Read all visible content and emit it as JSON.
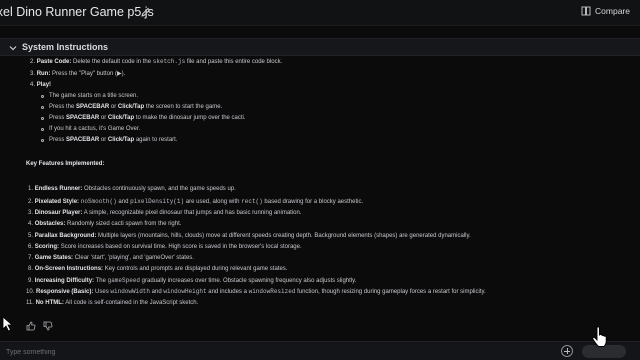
{
  "header": {
    "title": "ixel Dino Runner Game p5.js",
    "compare_label": "Compare"
  },
  "system_instructions": {
    "label": "System Instructions"
  },
  "steps": [
    {
      "num": "2.",
      "label": "Paste Code:",
      "text_a": " Delete the default code in the ",
      "code": "sketch.js",
      "text_b": " file and paste this entire code block."
    },
    {
      "num": "3.",
      "label": "Run:",
      "text_a": " Press the \"Play\" button (▶)."
    },
    {
      "num": "4.",
      "label": "Play!"
    }
  ],
  "play_bullets": [
    {
      "text_a": "The game starts on a title screen."
    },
    {
      "text_a": "Press the ",
      "bold1": "SPACEBAR",
      "text_b": " or ",
      "bold2": "Click/Tap",
      "text_c": " the screen to start the game."
    },
    {
      "text_a": "Press ",
      "bold1": "SPACEBAR",
      "text_b": " or ",
      "bold2": "Click/Tap",
      "text_c": " to make the dinosaur jump over the cacti."
    },
    {
      "text_a": "If you hit a cactus, it's Game Over."
    },
    {
      "text_a": "Press ",
      "bold1": "SPACEBAR",
      "text_b": " or ",
      "bold2": "Click/Tap",
      "text_c": " again to restart."
    }
  ],
  "features_heading": "Key Features Implemented:",
  "features": [
    {
      "num": "1.",
      "label": "Endless Runner:",
      "text_a": " Obstacles continuously spawn, and the game speeds up."
    },
    {
      "num": "2.",
      "label": "Pixelated Style:",
      "code1": "noSmooth()",
      "text_a": " and ",
      "code2": "pixelDensity(1)",
      "text_b": " are used, along with ",
      "code3": "rect()",
      "text_c": " based drawing for a blocky aesthetic."
    },
    {
      "num": "3.",
      "label": "Dinosaur Player:",
      "text_a": " A simple, recognizable pixel dinosaur that jumps and has basic running animation."
    },
    {
      "num": "4.",
      "label": "Obstacles:",
      "text_a": " Randomly sized cacti spawn from the right."
    },
    {
      "num": "5.",
      "label": "Parallax Background:",
      "text_a": " Multiple layers (mountains, hills, clouds) move at different speeds creating depth. Background elements (shapes) are generated dynamically."
    },
    {
      "num": "6.",
      "label": "Scoring:",
      "text_a": " Score increases based on survival time. High score is saved in the browser's local storage."
    },
    {
      "num": "7.",
      "label": "Game States:",
      "text_a": " Clear 'start', 'playing', and 'gameOver' states."
    },
    {
      "num": "8.",
      "label": "On-Screen Instructions:",
      "text_a": " Key controls and prompts are displayed during relevant game states."
    },
    {
      "num": "9.",
      "label": "Increasing Difficulty:",
      "text_a": " The ",
      "code1": "gameSpeed",
      "text_b": " gradually increases over time. Obstacle spawning frequency also adjusts slightly."
    },
    {
      "num": "10.",
      "label": "Responsive (Basic):",
      "text_a": " Uses ",
      "code1": "windowWidth",
      "text_b": " and ",
      "code2": "windowHeight",
      "text_c": " and includes a ",
      "code3": "windowResized",
      "text_d": " function, though resizing during gameplay forces a restart for simplicity."
    },
    {
      "num": "11.",
      "label": "No HTML:",
      "text_a": " All code is self-contained in the JavaScript sketch."
    }
  ],
  "input": {
    "placeholder": "Type something"
  },
  "icons": {
    "edit": "pencil-icon",
    "compare": "compare-icon",
    "chevron": "chevron-down-icon",
    "thumb_up": "thumbs-up-icon",
    "thumb_down": "thumbs-down-icon",
    "add": "add-icon"
  }
}
